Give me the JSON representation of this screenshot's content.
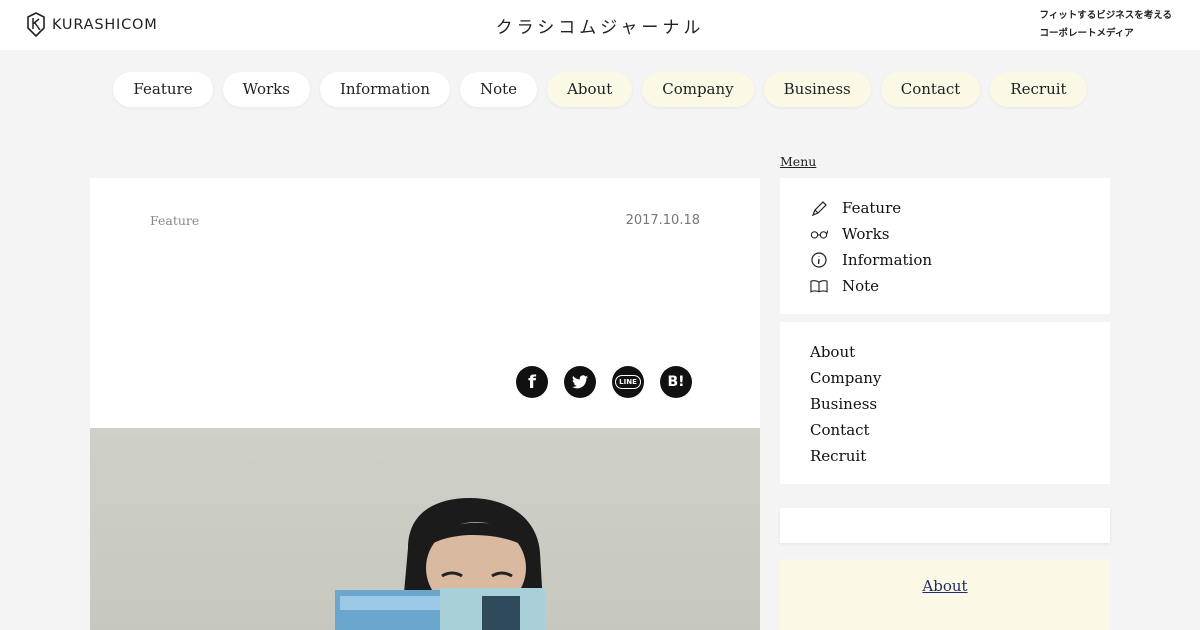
{
  "header": {
    "logo_text": "KURASHICOM",
    "site_title": "クラシコムジャーナル",
    "tagline_line1": "フィットするビジネスを考える",
    "tagline_line2": "コーポレートメディア"
  },
  "nav": {
    "items": [
      {
        "label": "Feature"
      },
      {
        "label": "Works"
      },
      {
        "label": "Information"
      },
      {
        "label": "Note"
      },
      {
        "label": "About"
      },
      {
        "label": "Company"
      },
      {
        "label": "Business"
      },
      {
        "label": "Contact"
      },
      {
        "label": "Recruit"
      }
    ]
  },
  "article": {
    "category": "Feature",
    "date": "2017.10.18",
    "title": "",
    "author_line1": "",
    "author_line2": "",
    "share_buttons": [
      {
        "icon": "facebook-icon",
        "glyph": "f"
      },
      {
        "icon": "twitter-icon",
        "glyph": ""
      },
      {
        "icon": "line-icon",
        "glyph": "LINE"
      },
      {
        "icon": "hatena-bookmark-icon",
        "glyph": "B!"
      }
    ]
  },
  "sidebar": {
    "menu_label": "Menu",
    "primary": [
      {
        "label": "Feature",
        "sub": "",
        "icon": "pen-icon"
      },
      {
        "label": "Works",
        "sub": "",
        "icon": "glasses-icon"
      },
      {
        "label": "Information",
        "sub": "",
        "icon": "info-icon"
      },
      {
        "label": "Note",
        "sub": "",
        "icon": "book-icon"
      }
    ],
    "secondary": [
      {
        "label": "About",
        "sub": ""
      },
      {
        "label": "Company",
        "sub": ""
      },
      {
        "label": "Business",
        "sub": ""
      },
      {
        "label": "Contact",
        "sub": ""
      },
      {
        "label": "Recruit",
        "sub": ""
      }
    ],
    "about_title": "About",
    "about_sub": ""
  },
  "colors": {
    "page_bg": "#f4f4f4",
    "pill_alt_bg": "#fbf8e6",
    "link_navy": "#1e2d6a"
  }
}
